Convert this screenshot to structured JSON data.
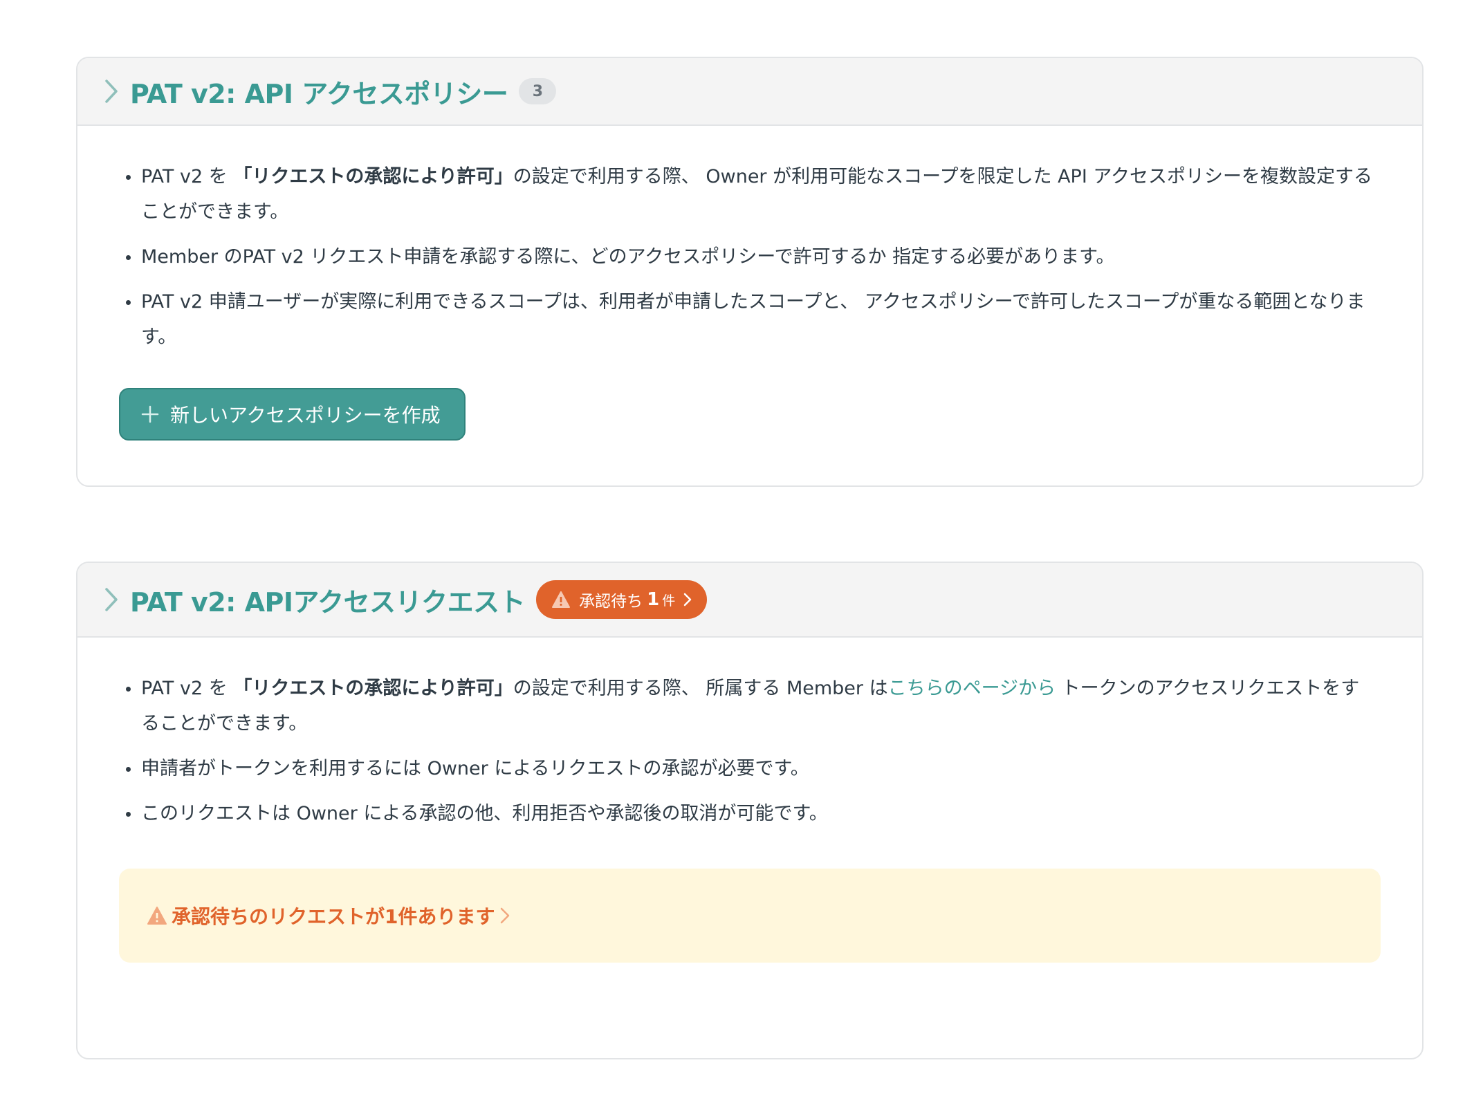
{
  "policy_section": {
    "title": "PAT v2: API アクセスポリシー",
    "count": "3",
    "bullets": [
      {
        "pre": "PAT v2 を ",
        "bold": "「リクエストの承認により許可」",
        "post": "の設定で利用する際、 Owner が利用可能なスコープを限定した API アクセスポリシーを複数設定することができます。"
      },
      {
        "text": "Member のPAT v2 リクエスト申請を承認する際に、どのアクセスポリシーで許可するか 指定する必要があります。"
      },
      {
        "text": "PAT v2 申請ユーザーが実際に利用できるスコープは、利用者が申請したスコープと、 アクセスポリシーで許可したスコープが重なる範囲となります。"
      }
    ],
    "create_button_label": "新しいアクセスポリシーを作成"
  },
  "request_section": {
    "title": "PAT v2: APIアクセスリクエスト",
    "pending_badge": {
      "label": "承認待ち",
      "count": "1",
      "unit": "件"
    },
    "bullets": [
      {
        "pre": "PAT v2 を ",
        "bold": "「リクエストの承認により許可」",
        "mid": "の設定で利用する際、 所属する Member は",
        "link": "こちらのページから",
        "post": " トークンのアクセスリクエストをすることができます。"
      },
      {
        "text": "申請者がトークンを利用するには Owner によるリクエストの承認が必要です。"
      },
      {
        "text": "このリクエストは Owner による承認の他、利用拒否や承認後の取消が可能です。"
      }
    ],
    "alert_text": "承認待ちのリクエストが1件あります"
  },
  "colors": {
    "accent": "#3a9a93",
    "button": "#439c95",
    "warning": "#e0632b",
    "alert_bg": "#fff7dc"
  },
  "icons": [
    "chevron-right-icon",
    "warning-icon",
    "plus-icon"
  ]
}
